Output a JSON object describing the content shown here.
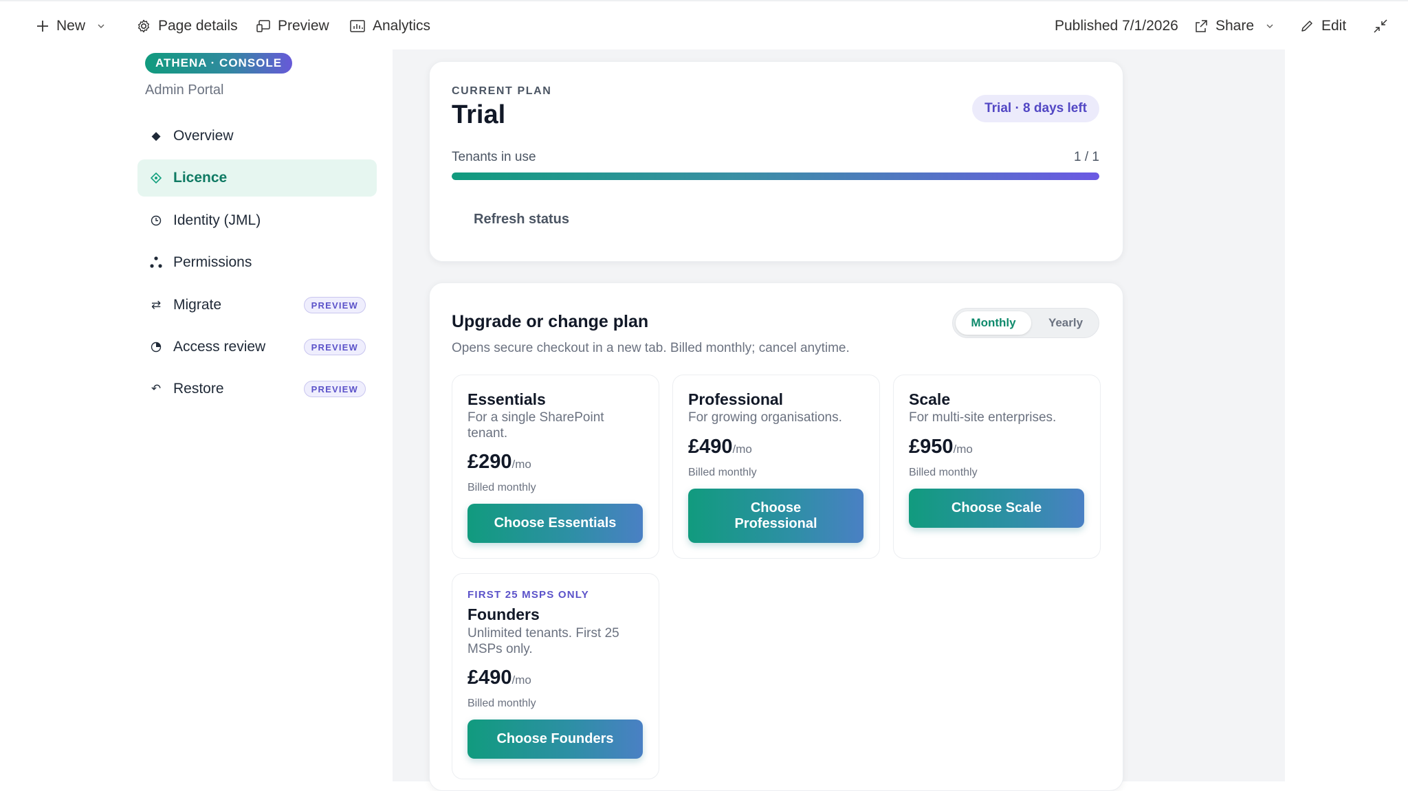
{
  "commandbar": {
    "new_label": "New",
    "page_details_label": "Page details",
    "preview_label": "Preview",
    "analytics_label": "Analytics",
    "published_label": "Published 7/1/2026",
    "share_label": "Share",
    "edit_label": "Edit"
  },
  "sidebar": {
    "brand": "ATHENA · CONSOLE",
    "subtitle": "Admin Portal",
    "items": [
      {
        "label": "Overview",
        "icon": "diamond-icon"
      },
      {
        "label": "Licence",
        "icon": "licence-icon",
        "active": true
      },
      {
        "label": "Identity (JML)",
        "icon": "clock-icon"
      },
      {
        "label": "Permissions",
        "icon": "dots-icon"
      },
      {
        "label": "Migrate",
        "icon": "swap-icon",
        "badge": "PREVIEW"
      },
      {
        "label": "Access review",
        "icon": "pie-icon",
        "badge": "PREVIEW"
      },
      {
        "label": "Restore",
        "icon": "undo-icon",
        "badge": "PREVIEW"
      }
    ]
  },
  "current_plan": {
    "label": "CURRENT PLAN",
    "name": "Trial",
    "trial_badge": "Trial · 8 days left",
    "tenants_label": "Tenants in use",
    "tenants_count": "1 / 1",
    "tenants_fraction": 1.0,
    "refresh_label": "Refresh status"
  },
  "upgrade": {
    "title": "Upgrade or change plan",
    "subtitle": "Opens secure checkout in a new tab. Billed monthly; cancel anytime.",
    "toggle": {
      "monthly": "Monthly",
      "yearly": "Yearly",
      "selected": "Monthly"
    },
    "plans": [
      {
        "name": "Essentials",
        "desc": "For a single SharePoint tenant.",
        "price": "£290",
        "per": "/mo",
        "billed": "Billed monthly",
        "button": "Choose Essentials"
      },
      {
        "name": "Professional",
        "desc": "For growing organisations.",
        "price": "£490",
        "per": "/mo",
        "billed": "Billed monthly",
        "button": "Choose Professional"
      },
      {
        "name": "Scale",
        "desc": "For multi-site enterprises.",
        "price": "£950",
        "per": "/mo",
        "billed": "Billed monthly",
        "button": "Choose Scale"
      },
      {
        "tag": "FIRST 25 MSPS ONLY",
        "name": "Founders",
        "desc": "Unlimited tenants. First 25 MSPs only.",
        "price": "£490",
        "per": "/mo",
        "billed": "Billed monthly",
        "button": "Choose Founders"
      }
    ]
  },
  "colors": {
    "accent_teal": "#119b7e",
    "accent_purple": "#6759d8",
    "active_nav_bg": "#e6f6f0",
    "badge_bg": "#efeefd"
  }
}
